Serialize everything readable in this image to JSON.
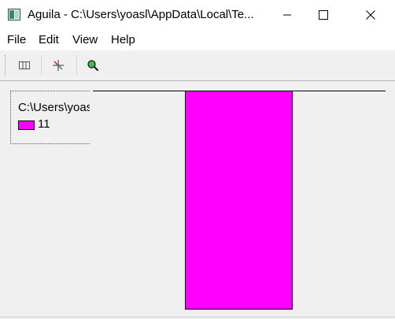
{
  "window": {
    "title": "Aguila - C:\\Users\\yoasl\\AppData\\Local\\Te...",
    "app_icon": "aguila-app-icon",
    "controls": [
      "minimize-icon",
      "maximize-icon",
      "close-icon"
    ]
  },
  "menu": {
    "items": [
      {
        "label": "File"
      },
      {
        "label": "Edit"
      },
      {
        "label": "View"
      },
      {
        "label": "Help"
      }
    ]
  },
  "toolbar": {
    "buttons": [
      {
        "icon": "columns-icon"
      },
      {
        "icon": "crosshair-icon"
      },
      {
        "icon": "zoom-icon"
      }
    ]
  },
  "legend": {
    "title": "C:\\Users\\yoasl",
    "entries": [
      {
        "label": "11",
        "color": "#ff00ff"
      }
    ]
  },
  "chart_data": {
    "type": "bar",
    "categories": [
      "11"
    ],
    "values": [
      1
    ],
    "colors": [
      "#ff00ff"
    ],
    "title": "",
    "xlabel": "",
    "ylabel": "",
    "ylim": [
      0,
      1
    ],
    "grid": false
  },
  "colors": {
    "titlebar_bg": "#ffffff",
    "window_bg": "#f0f0f0",
    "bar": "#ff00ff"
  }
}
